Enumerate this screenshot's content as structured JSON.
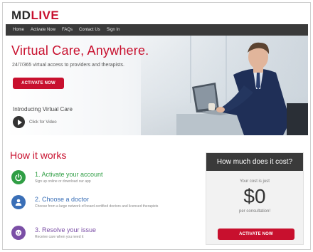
{
  "logo": {
    "text_main": "MD",
    "text_accent": "LIVE"
  },
  "nav": {
    "items": [
      "Home",
      "Activate Now",
      "FAQs",
      "Contact Us",
      "Sign In"
    ]
  },
  "hero": {
    "title": "Virtual Care, Anywhere.",
    "subtitle": "24/7/365 virtual access to providers and therapists.",
    "button_label": "ACTIVATE NOW",
    "intro_label": "Introducing Virtual Care",
    "video_label": "Click for Video"
  },
  "how_it_works": {
    "title": "How it works",
    "steps": [
      {
        "title": "1. Activate your account",
        "desc": "Sign up online or download our app",
        "icon": "power-icon"
      },
      {
        "title": "2. Choose a doctor",
        "desc": "Choose from a large network of board-certified doctors and licensed therapists",
        "icon": "doctor-icon"
      },
      {
        "title": "3. Resolve your issue",
        "desc": "Receive care when you need it",
        "icon": "chat-icon"
      }
    ]
  },
  "cost": {
    "title": "How much does it cost?",
    "line": "Your cost is just",
    "amount": "$0",
    "per": "per consultation!",
    "button_label": "ACTIVATE NOW"
  },
  "colors": {
    "brand_red": "#c8102e",
    "nav_dark": "#3a3a3a",
    "step1": "#2f9e44",
    "step2": "#3a6fb7",
    "step3": "#7b4fa6"
  }
}
